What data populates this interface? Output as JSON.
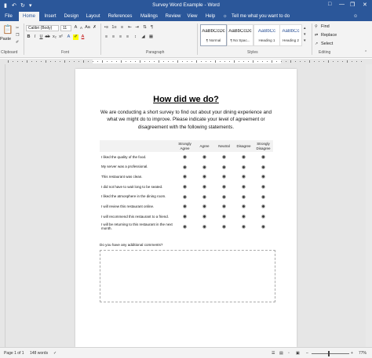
{
  "titlebar": {
    "title": "Survey Word Example  -  Word",
    "qa_save_icon": "save-icon",
    "qa_undo_icon": "undo-icon",
    "qa_redo_icon": "redo-icon",
    "restore_icon": "restore-icon"
  },
  "tabs": [
    "File",
    "Home",
    "Insert",
    "Design",
    "Layout",
    "References",
    "Mailings",
    "Review",
    "View",
    "Help"
  ],
  "active_tab": "Home",
  "tellme": "Tell me what you want to do",
  "ribbon": {
    "paste_label": "Paste",
    "font_name": "Calibri (Body)",
    "font_size": "11",
    "groups": {
      "clipboard": "Clipboard",
      "font": "Font",
      "paragraph": "Paragraph",
      "styles": "Styles",
      "editing": "Editing"
    },
    "styles": [
      {
        "preview": "AaBbCcDc",
        "name": "¶ Normal"
      },
      {
        "preview": "AaBbCcDc",
        "name": "¶ No Spac..."
      },
      {
        "preview": "AaBbCc",
        "name": "Heading 1"
      },
      {
        "preview": "AaBbCc",
        "name": "Heading 2"
      }
    ],
    "editing": {
      "find": "Find",
      "replace": "Replace",
      "select": "Select"
    }
  },
  "document": {
    "heading": "How did we do?",
    "intro": "We are conducting a short survey to find out about your dining experience and what we might do to improve. Please indicate your level of agreement or disagreement with the following statements.",
    "columns": [
      "Strongly Agree",
      "Agree",
      "Neutral",
      "Disagree",
      "Strongly Disagree"
    ],
    "statements": [
      "I liked the quality of the food.",
      "My server was a professional.",
      "This restaurant was clean.",
      "I did not have to wait long to be seated.",
      "I liked the atmosphere in the dining room.",
      "I will review this restaurant online.",
      "I will recommend this restaurant to a friend.",
      "I will be returning to this restaurant in the next month."
    ],
    "radio_glyph": "◉",
    "comment_label": "Do you have any additional comments?"
  },
  "statusbar": {
    "page": "Page 1 of 1",
    "words": "148 words",
    "zoom": "77%"
  },
  "colors": {
    "accent": "#2b579a",
    "ribbon": "#f3f3f3",
    "canvas": "#e6e6e6"
  }
}
